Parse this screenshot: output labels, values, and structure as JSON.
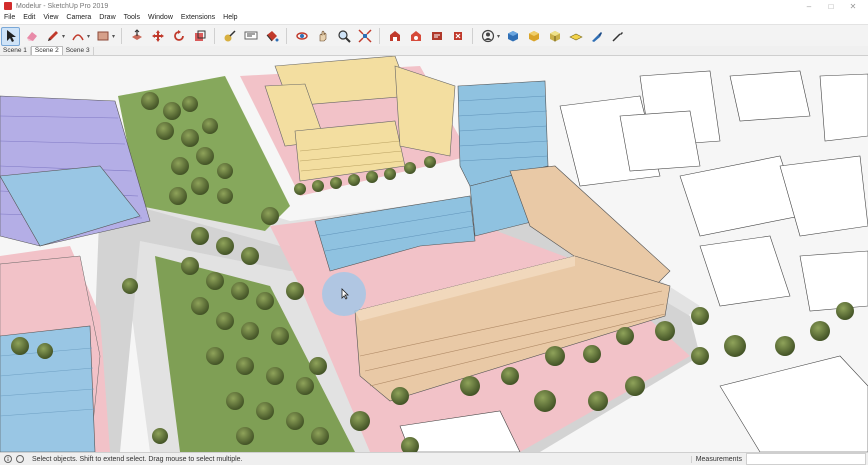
{
  "window": {
    "title": "Modelur - SketchUp Pro 2019"
  },
  "menu": [
    "File",
    "Edit",
    "View",
    "Camera",
    "Draw",
    "Tools",
    "Window",
    "Extensions",
    "Help"
  ],
  "toolbar": {
    "tools": [
      "select-tool",
      "eraser-tool",
      "pencil-tool",
      "arc-tool",
      "rectangle-tool",
      "push-pull-tool",
      "move-tool",
      "rotate-tool",
      "scale-tool",
      "offset-tool",
      "tape-measure-tool",
      "text-tool",
      "paint-bucket-tool",
      "orbit-tool",
      "pan-tool",
      "zoom-tool",
      "zoom-extents-tool",
      "previous-view-tool",
      "section-plane-tool",
      "warehouse-tool",
      "extension-warehouse-tool",
      "account-tool",
      "component-tool",
      "material-tool",
      "solid-tools",
      "sandbox-tool",
      "eyedropper-tool",
      "styles-tool"
    ]
  },
  "scenes": [
    "Scene 1",
    "Scene 2",
    "Scene 3"
  ],
  "active_scene": "Scene 2",
  "status": {
    "message": "Select objects. Shift to extend select. Drag mouse to select multiple.",
    "measurements_label": "Measurements"
  },
  "colors": {
    "ground_pink": "#f2c2c8",
    "grass": "#7fa05a",
    "building_tan": "#e9c9a6",
    "building_blue": "#8fc2e0",
    "building_yellow": "#f3dea0",
    "building_purple": "#b4aee6",
    "road": "#e4e4e4"
  }
}
